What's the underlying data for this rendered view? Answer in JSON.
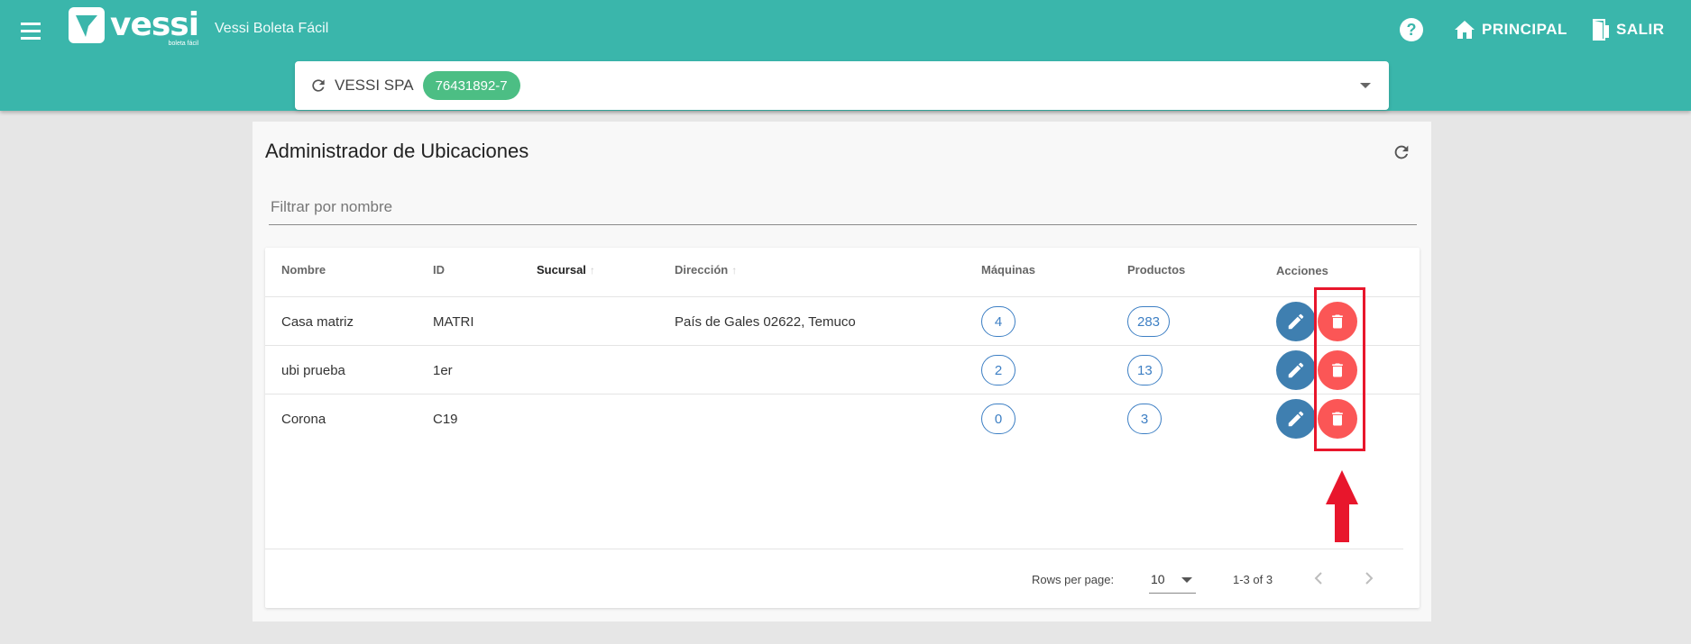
{
  "header": {
    "logo_text": "vessi",
    "logo_subtext": "boleta fácil",
    "app_title": "Vessi Boleta Fácil",
    "help_label": "?",
    "nav_principal": "PRINCIPAL",
    "nav_salir": "SALIR"
  },
  "company": {
    "name": "VESSI SPA",
    "rut": "76431892-7"
  },
  "page": {
    "title": "Administrador de Ubicaciones",
    "filter_placeholder": "Filtrar por nombre"
  },
  "table": {
    "headers": {
      "nombre": "Nombre",
      "id": "ID",
      "sucursal": "Sucursal",
      "direccion": "Dirección",
      "maquinas": "Máquinas",
      "productos": "Productos",
      "acciones": "Acciones"
    },
    "rows": [
      {
        "nombre": "Casa matriz",
        "id": "MATRI",
        "sucursal": "",
        "direccion": "País de Gales 02622, Temuco",
        "maquinas": "4",
        "productos": "283"
      },
      {
        "nombre": "ubi prueba",
        "id": "1er",
        "sucursal": "",
        "direccion": "",
        "maquinas": "2",
        "productos": "13"
      },
      {
        "nombre": "Corona",
        "id": "C19",
        "sucursal": "",
        "direccion": "",
        "maquinas": "0",
        "productos": "3"
      }
    ]
  },
  "pagination": {
    "rows_per_page_label": "Rows per page:",
    "rows_per_page_value": "10",
    "range_text": "1-3 of 3"
  },
  "colors": {
    "header_bg": "#3ab6ab",
    "chip_green": "#4cbe84",
    "edit_blue": "#3f7fb0",
    "delete_red": "#fb5656",
    "annotation_red": "#e8162c"
  },
  "icons": {
    "menu": "menu-icon",
    "help": "help-icon",
    "home": "home-icon",
    "exit": "exit-door-icon",
    "refresh": "refresh-icon",
    "edit": "pencil-icon",
    "delete": "trash-icon",
    "prev": "chevron-left-icon",
    "next": "chevron-right-icon",
    "annotation": "arrow-up-icon"
  }
}
